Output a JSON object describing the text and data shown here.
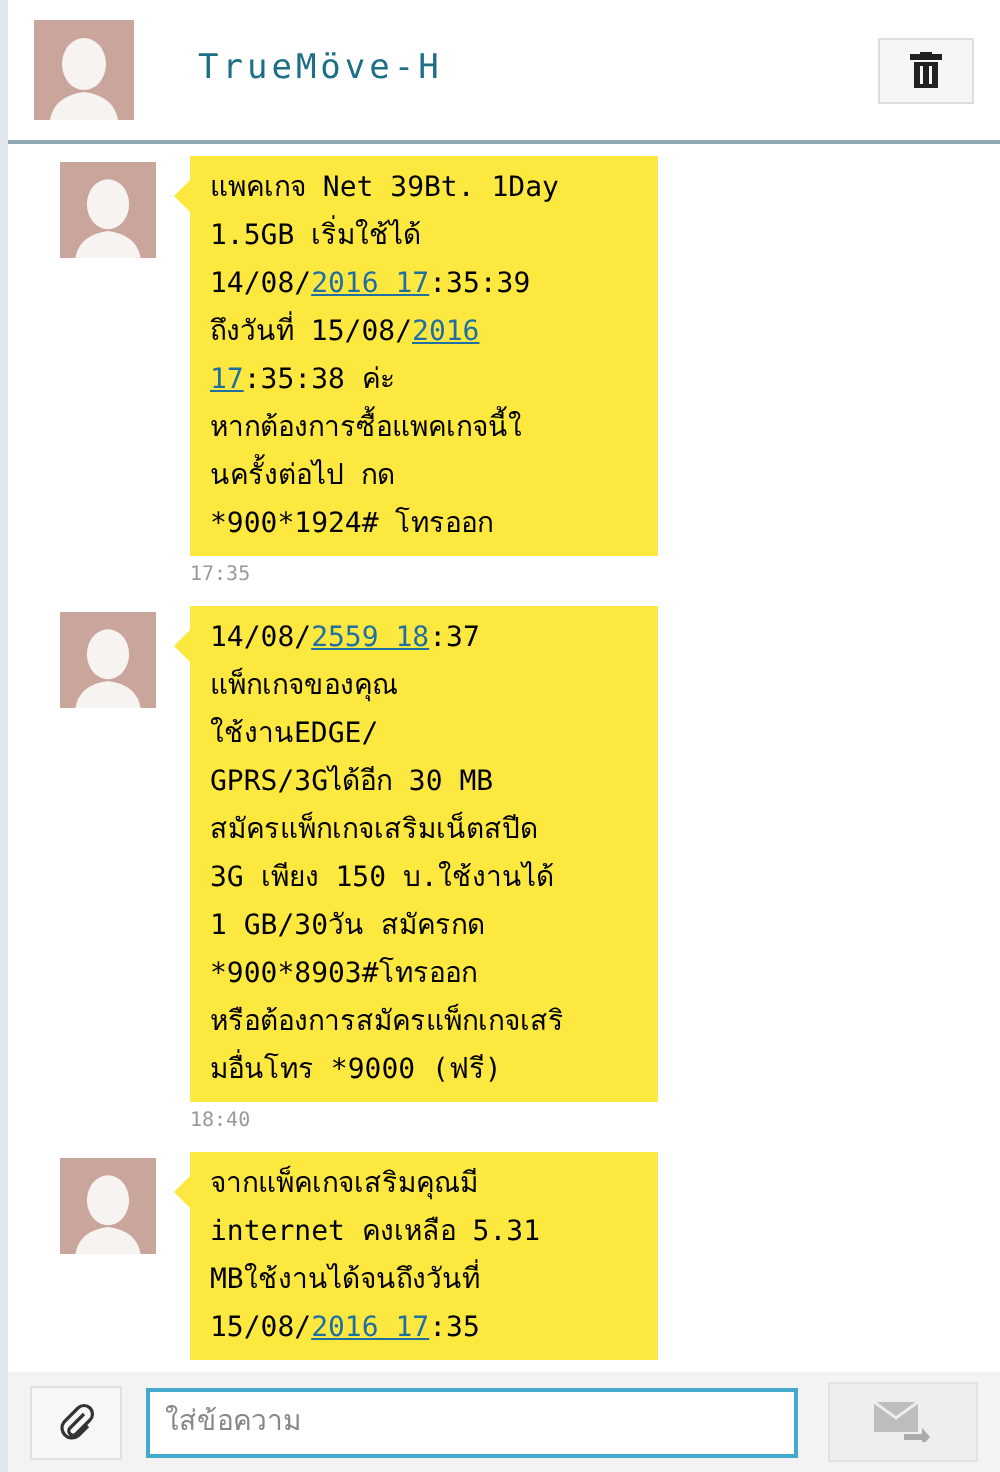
{
  "header": {
    "contact_name": "TrueMöve-H"
  },
  "messages": [
    {
      "parts": [
        {
          "text": "แพคเกจ Net 39Bt. 1Day\n1.5GB เริ่มใช้ได้\n14/08/",
          "link": false
        },
        {
          "text": "2016 17",
          "link": true
        },
        {
          "text": ":35:39\nถึงวันที่ 15/08/",
          "link": false
        },
        {
          "text": "2016",
          "link": true
        },
        {
          "text": "\n17",
          "link": true
        },
        {
          "text": ":35:38 ค่ะ\nหากต้องการซื้อแพคเกจนี้ใ\nนครั้งต่อไป กด\n*900*1924# โทรออก",
          "link": false
        }
      ],
      "time": "17:35"
    },
    {
      "parts": [
        {
          "text": "14/08/",
          "link": false
        },
        {
          "text": "2559 18",
          "link": true
        },
        {
          "text": ":37\nแพ็กเกจของคุณ\nใช้งานEDGE/\nGPRS/3Gได้อีก 30 MB\nสมัครแพ็กเกจเสริมเน็ตสปีด\n3G เพียง 150 บ.ใช้งานได้\n1 GB/30วัน สมัครกด\n*900*8903#โทรออก\nหรือต้องการสมัครแพ็กเกจเสริ\nมอื่นโทร *9000 (ฟรี)",
          "link": false
        }
      ],
      "time": "18:40"
    },
    {
      "parts": [
        {
          "text": "จากแพ็คเกจเสริมคุณมี\ninternet คงเหลือ 5.31\nMBใช้งานได้จนถึงวันที่\n15/08/",
          "link": false
        },
        {
          "text": "2016 17",
          "link": true
        },
        {
          "text": ":35",
          "link": false
        }
      ]
    }
  ],
  "composer": {
    "placeholder": "ใส่ข้อความ"
  }
}
